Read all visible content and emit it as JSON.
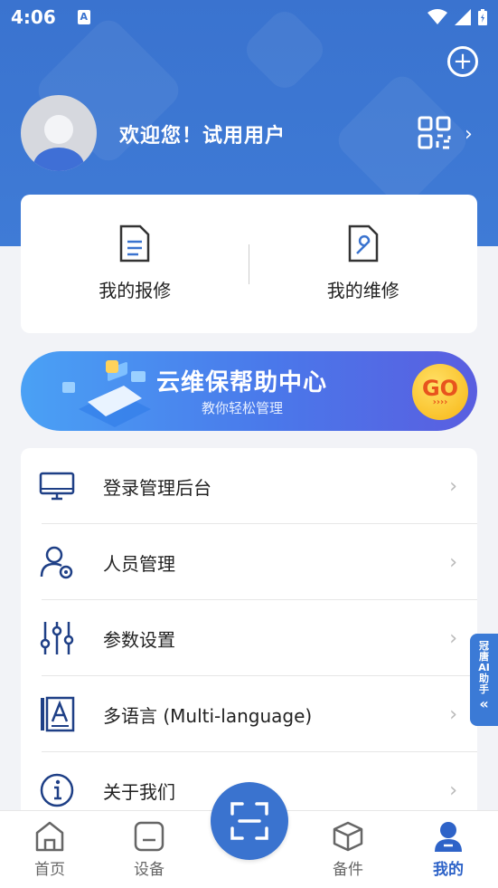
{
  "status_bar": {
    "time": "4:06",
    "sim_label": "A"
  },
  "header": {
    "greeting": "欢迎您！试用用户",
    "add_icon": "plus-circle-icon",
    "qr_icon": "qr-code-icon",
    "accent_color": "#3a73cf"
  },
  "quick_actions": [
    {
      "label": "我的报修",
      "icon": "document-list-icon"
    },
    {
      "label": "我的维修",
      "icon": "document-wrench-icon"
    }
  ],
  "banner": {
    "title": "云维保帮助中心",
    "subtitle": "教你轻松管理",
    "button": "GO",
    "button_arrows": "››››"
  },
  "menu": [
    {
      "label": "登录管理后台",
      "icon": "monitor-icon"
    },
    {
      "label": "人员管理",
      "icon": "user-settings-icon"
    },
    {
      "label": "参数设置",
      "icon": "sliders-icon"
    },
    {
      "label": "多语言 (Multi-language)",
      "icon": "language-icon"
    },
    {
      "label": "关于我们",
      "icon": "info-icon"
    }
  ],
  "ai_tab": {
    "label_lines": [
      "冠",
      "唐",
      "AI",
      "助",
      "手"
    ],
    "arrow": "«"
  },
  "bottom_nav": [
    {
      "label": "首页",
      "icon": "home-icon",
      "active": false
    },
    {
      "label": "设备",
      "icon": "device-icon",
      "active": false
    },
    {
      "label": "备件",
      "icon": "box-icon",
      "active": false
    },
    {
      "label": "我的",
      "icon": "profile-icon",
      "active": true
    }
  ],
  "scan_icon": "scan-icon"
}
